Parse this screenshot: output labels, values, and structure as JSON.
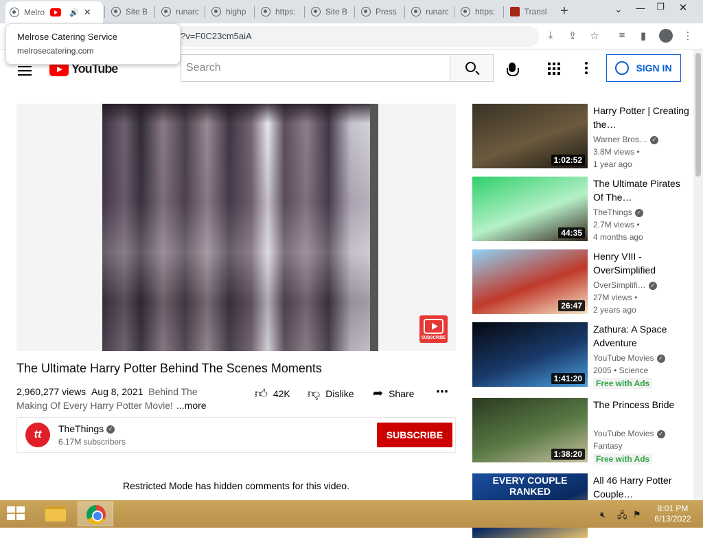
{
  "browser": {
    "tabs": [
      {
        "label": "Melro",
        "type": "globe",
        "active": true
      },
      {
        "label": "Site B",
        "type": "globe"
      },
      {
        "label": "runarc",
        "type": "globe"
      },
      {
        "label": "highp",
        "type": "globe"
      },
      {
        "label": "https:",
        "type": "globe"
      },
      {
        "label": "Site B",
        "type": "globe"
      },
      {
        "label": "Press",
        "type": "globe"
      },
      {
        "label": "runarc",
        "type": "globe"
      },
      {
        "label": "https:",
        "type": "globe"
      },
      {
        "label": "Transl",
        "type": "translate"
      }
    ],
    "new_tab_icon": "plus-icon",
    "url": "?v=F0C23cm5aiA"
  },
  "tooltip": {
    "title": "Melrose Catering Service",
    "domain": "melrosecatering.com"
  },
  "youtube": {
    "logo_text": "YouTube",
    "search_placeholder": "Search",
    "signin_label": "SIGN IN"
  },
  "video": {
    "title": "The Ultimate Harry Potter Behind The Scenes Moments",
    "views": "2,960,277 views",
    "date": "Aug 8, 2021",
    "description": "Behind The Making Of Every Harry Potter Movie!",
    "more_label": "...more",
    "likes": "42K",
    "dislike_label": "Dislike",
    "share_label": "Share",
    "watermark_label": "SUBSCRIBE"
  },
  "channel": {
    "avatar_text": "tt",
    "name": "TheThings",
    "subscribers": "6.17M subscribers",
    "subscribe_label": "SUBSCRIBE"
  },
  "comments_notice": "Restricted Mode has hidden comments for this video.",
  "related": [
    {
      "title": "Harry Potter | Creating the…",
      "channel": "Warner Bros…",
      "line3": "3.8M views •",
      "line4": "1 year ago",
      "duration": "1:02:52",
      "thumb_colors": [
        "#3a3226",
        "#6b5a3e",
        "#1e1a14"
      ]
    },
    {
      "title": "The Ultimate Pirates Of The…",
      "channel": "TheThings",
      "line3": "2.7M views •",
      "line4": "4 months ago",
      "duration": "44:35",
      "thumb_colors": [
        "#2fd06a",
        "#b5f0c8",
        "#3a2a20"
      ]
    },
    {
      "title": "Henry VIII - OverSimplified",
      "channel": "OverSimplifi…",
      "line3": "27M views •",
      "line4": "2 years ago",
      "duration": "26:47",
      "thumb_colors": [
        "#8fd3f5",
        "#c0392b",
        "#f5e6c8"
      ]
    },
    {
      "title": "Zathura: A Space Adventure",
      "channel": "YouTube Movies",
      "line3": "2005 • Science",
      "line4": "Free with Ads",
      "duration": "1:41:20",
      "thumb_colors": [
        "#05080f",
        "#1a3a6a",
        "#4aa0e0"
      ]
    },
    {
      "title": "The Princess Bride",
      "channel": "YouTube Movies",
      "line3": "Fantasy",
      "line4": "Free with Ads",
      "duration": "1:38:20",
      "thumb_colors": [
        "#2a3a22",
        "#5a7a45",
        "#c8c0a0"
      ]
    },
    {
      "title": "All 46 Harry Potter Couple…",
      "thumb_text": "EVERY COUPLE RANKED",
      "thumb_colors": [
        "#1a4fa0",
        "#0a2a60",
        "#e8c070"
      ]
    }
  ],
  "taskbar": {
    "time": "8:01 PM",
    "date": "6/13/2022"
  }
}
